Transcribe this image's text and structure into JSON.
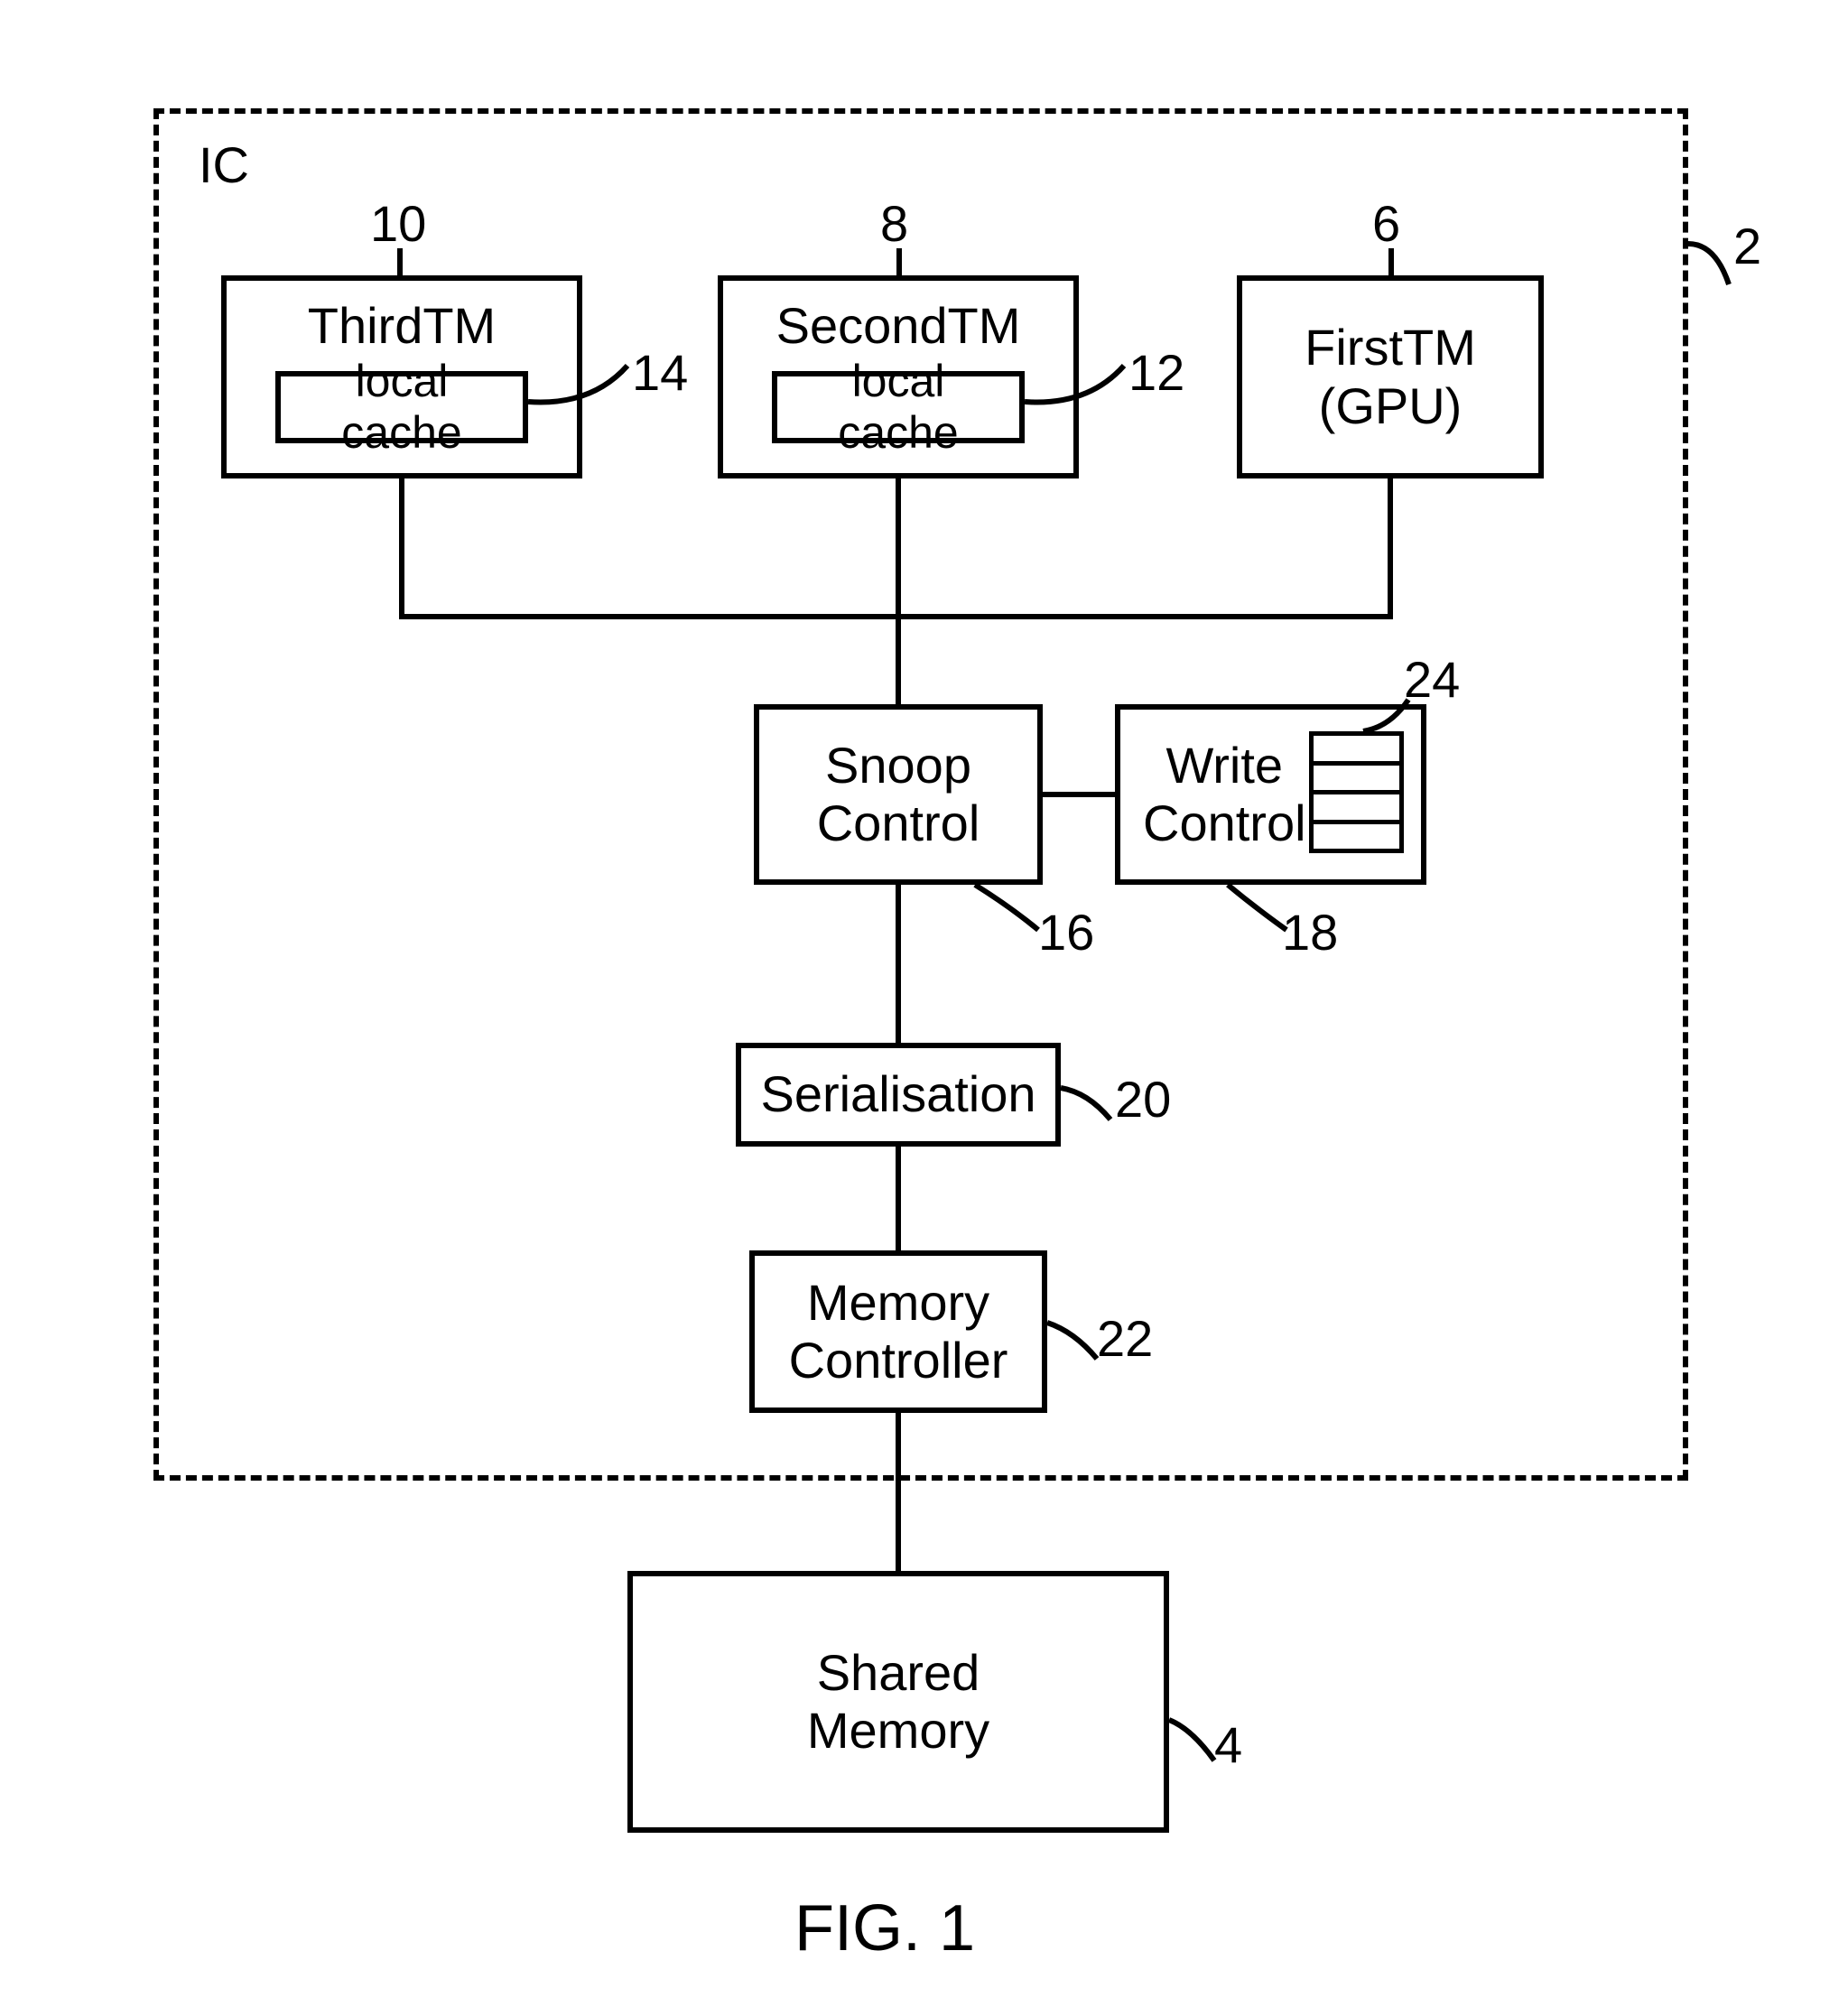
{
  "ic_label": "IC",
  "ic_ref": "2",
  "third_tm": {
    "title": "ThirdTM",
    "cache": "local cache",
    "ref_block": "10",
    "ref_cache": "14"
  },
  "second_tm": {
    "title": "SecondTM",
    "cache": "local cache",
    "ref_block": "8",
    "ref_cache": "12"
  },
  "first_tm": {
    "title_line1": "FirstTM",
    "title_line2": "(GPU)",
    "ref_block": "6"
  },
  "snoop": {
    "title_line1": "Snoop",
    "title_line2": "Control",
    "ref": "16"
  },
  "write": {
    "title_line1": "Write",
    "title_line2": "Control",
    "ref_block": "18",
    "ref_buffer": "24"
  },
  "serialisation": {
    "title": "Serialisation",
    "ref": "20"
  },
  "memctrl": {
    "title_line1": "Memory",
    "title_line2": "Controller",
    "ref": "22"
  },
  "shared": {
    "title_line1": "Shared",
    "title_line2": "Memory",
    "ref": "4"
  },
  "figure_label": "FIG. 1"
}
